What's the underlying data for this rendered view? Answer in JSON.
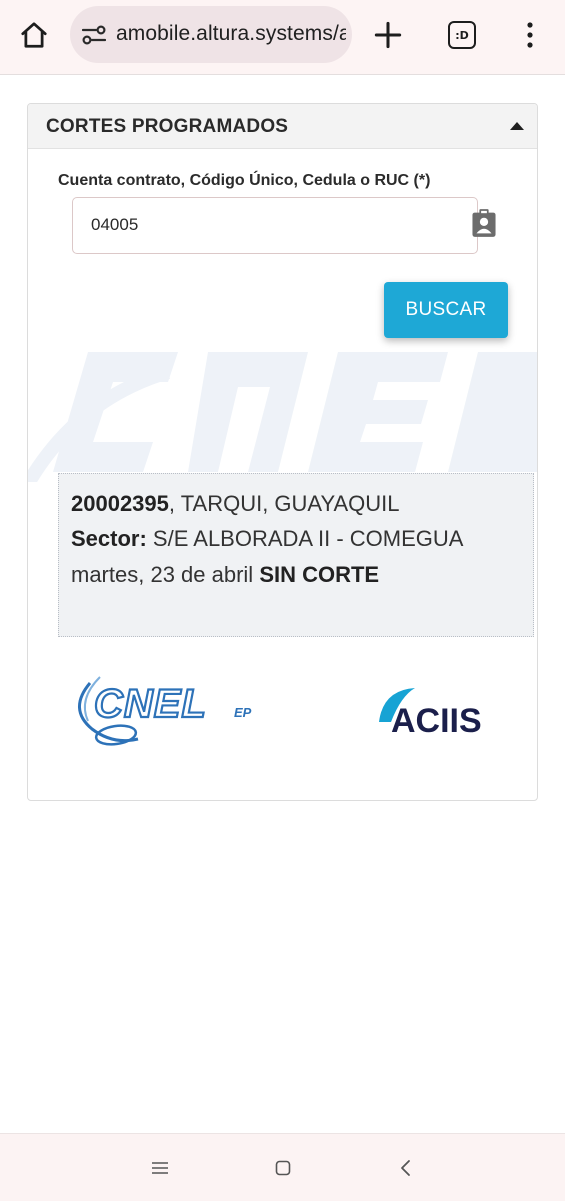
{
  "browser": {
    "url": "amobile.altura.systems/a",
    "tab_switcher_label": ":D"
  },
  "card": {
    "title": "CORTES PROGRAMADOS",
    "field_label": "Cuenta contrato, Código Único, Cedula o RUC (*)",
    "input_value": "04005",
    "search_label": "BUSCAR"
  },
  "result": {
    "account": "20002395",
    "location": ", TARQUI, GUAYAQUIL",
    "sector_label": "Sector:",
    "sector_value": " S/E ALBORADA II - COMEGUA",
    "date": "martes, 23 de abril ",
    "status": "SIN CORTE"
  },
  "logos": {
    "cnel_text": "CNEL",
    "cnel_suffix": "EP",
    "aciis_text": "ACIIS"
  },
  "colors": {
    "accent": "#1ea8d6",
    "cnel_blue": "#2d72b8",
    "aciis_navy": "#1b1f4b",
    "aciis_arc": "#17a3d4"
  },
  "icons": {
    "home": "home-icon",
    "site_settings": "tune-icon",
    "new_tab": "plus-icon",
    "menu": "more-vert-icon",
    "collapse": "caret-up-icon",
    "contact": "contact-card-icon"
  }
}
